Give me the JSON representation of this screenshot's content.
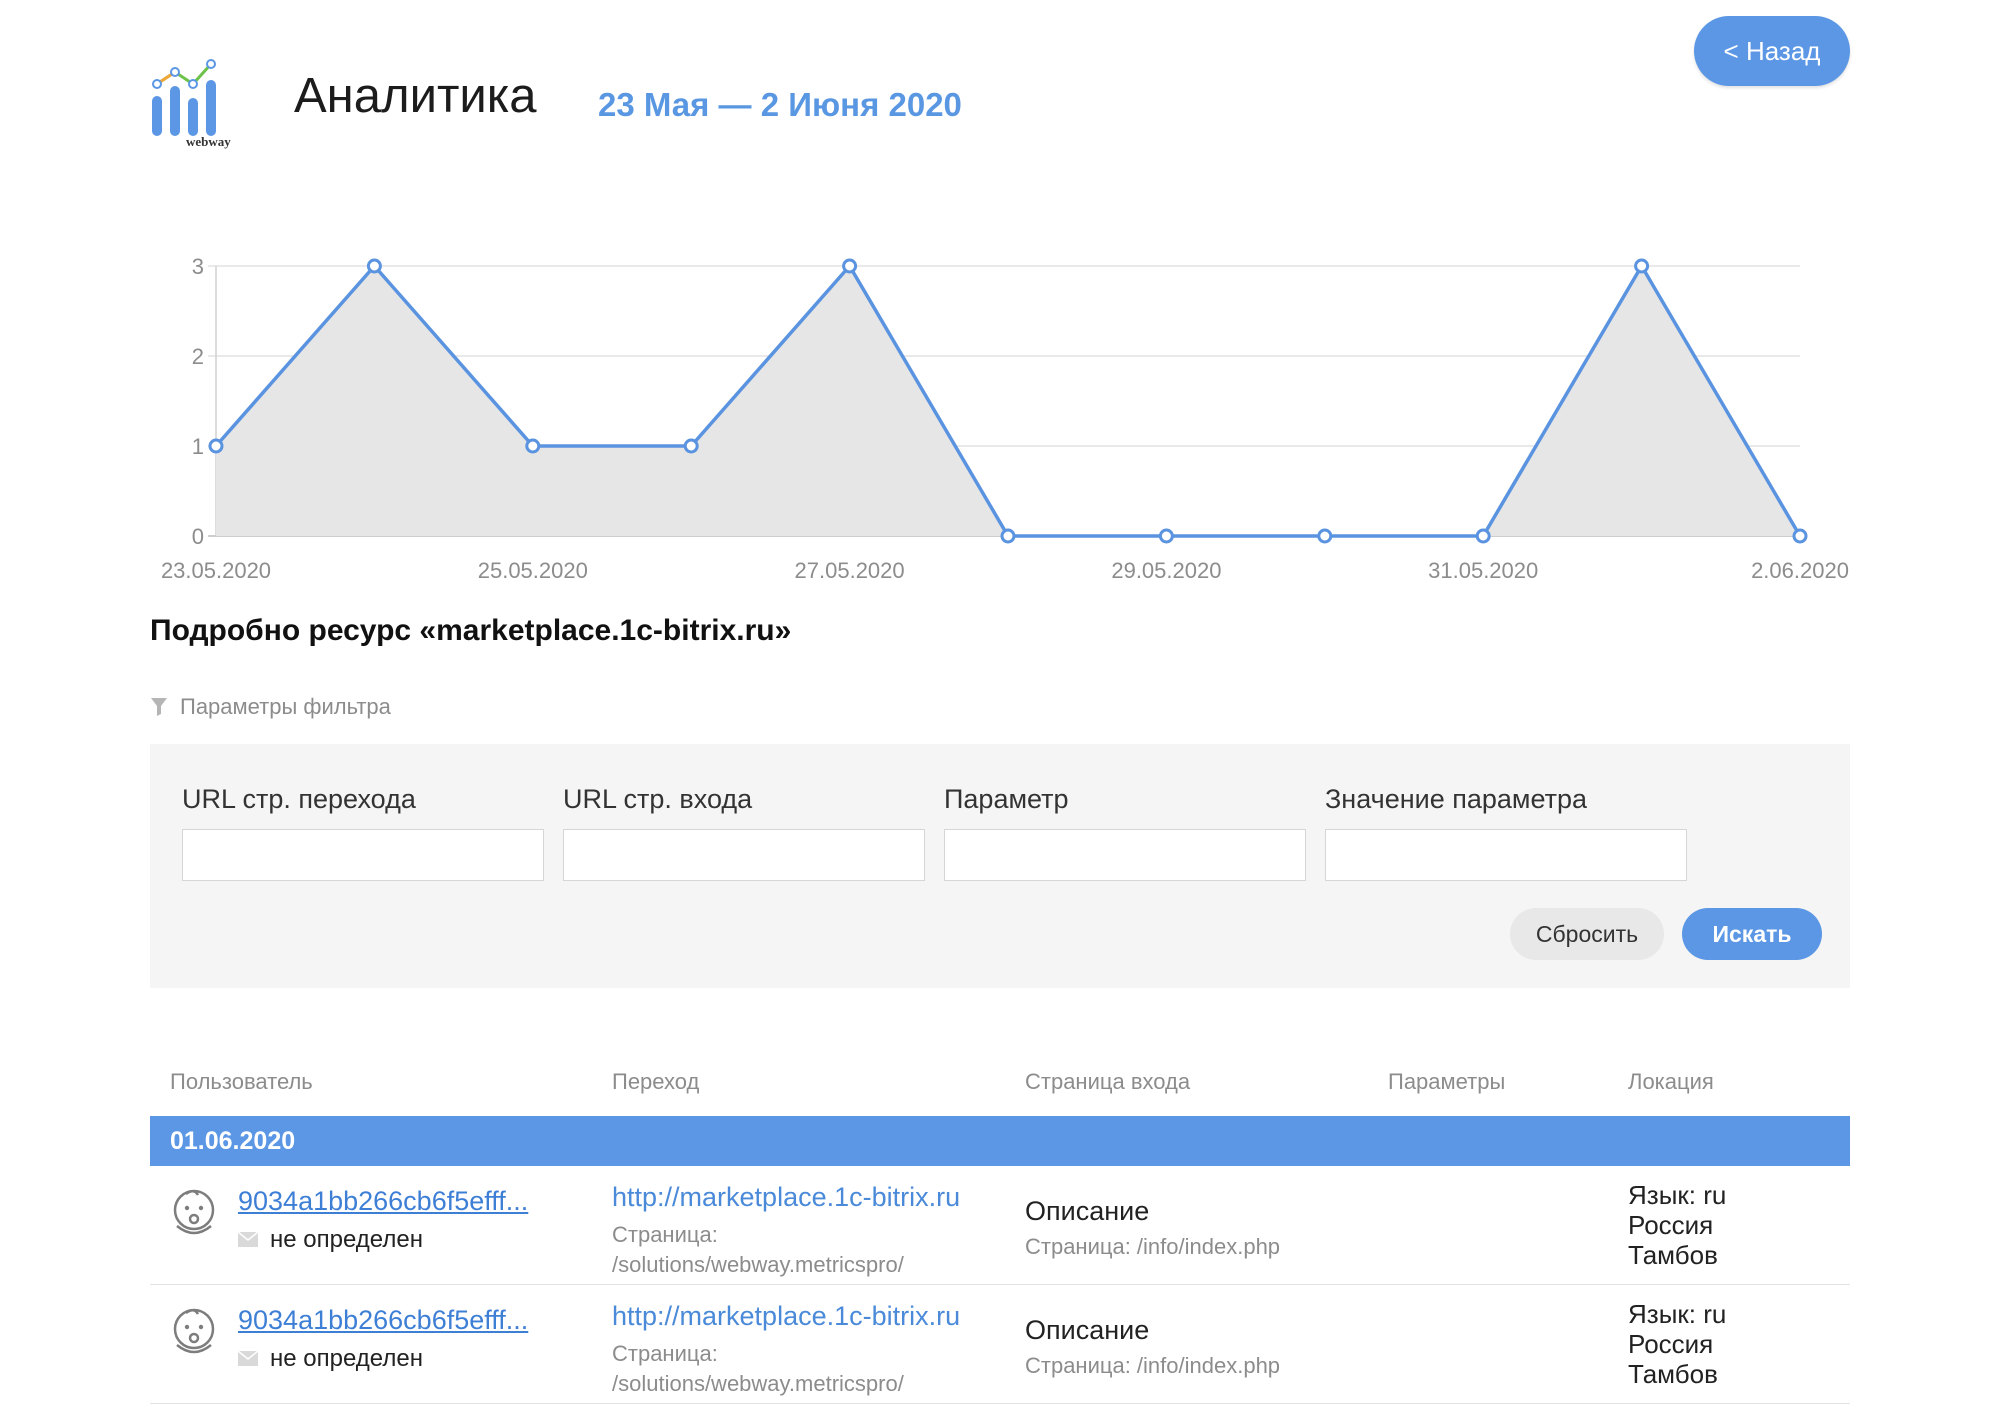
{
  "header": {
    "logo_text": "webway",
    "title": "Аналитика",
    "date_range": "23 Мая — 2 Июня 2020",
    "back_label": "< Назад"
  },
  "colors": {
    "accent": "#5b97e5",
    "chart_line": "#5a93e0",
    "chart_fill": "#e6e6e6"
  },
  "chart_data": {
    "type": "area",
    "x": [
      "23.05.2020",
      "24.05.2020",
      "25.05.2020",
      "26.05.2020",
      "27.05.2020",
      "28.05.2020",
      "29.05.2020",
      "30.05.2020",
      "31.05.2020",
      "1.06.2020",
      "2.06.2020"
    ],
    "x_tick_labels": [
      "23.05.2020",
      "25.05.2020",
      "27.05.2020",
      "29.05.2020",
      "31.05.2020",
      "2.06.2020"
    ],
    "series": [
      {
        "values": [
          1,
          3,
          1,
          1,
          3,
          0,
          0,
          0,
          0,
          3,
          0
        ]
      }
    ],
    "ylim": [
      0,
      3
    ],
    "y_ticks": [
      0,
      1,
      2,
      3
    ],
    "grid": true
  },
  "section": {
    "title": "Подробно ресурс «marketplace.1c-bitrix.ru»",
    "filter_toggle": "Параметры фильтра"
  },
  "filter": {
    "fields": [
      {
        "label": "URL стр. перехода",
        "value": ""
      },
      {
        "label": "URL стр. входа",
        "value": ""
      },
      {
        "label": "Параметр",
        "value": ""
      },
      {
        "label": "Значение параметра",
        "value": ""
      }
    ],
    "reset_label": "Сбросить",
    "search_label": "Искать"
  },
  "table": {
    "columns": [
      "Пользователь",
      "Переход",
      "Страница входа",
      "Параметры",
      "Локация"
    ],
    "date_group": "01.06.2020",
    "rows": [
      {
        "user_id": "9034a1bb266cb6f5efff...",
        "user_status": "не определен",
        "ref_url": "http://marketplace.1c-bitrix.ru",
        "ref_page_label": "Страница:",
        "ref_page": "/solutions/webway.metricspro/",
        "entry_title": "Описание",
        "entry_page": "Страница: /info/index.php",
        "params": "",
        "lang": "Язык: ru",
        "country": "Россия",
        "city": "Тамбов"
      },
      {
        "user_id": "9034a1bb266cb6f5efff...",
        "user_status": "не определен",
        "ref_url": "http://marketplace.1c-bitrix.ru",
        "ref_page_label": "Страница:",
        "ref_page": "/solutions/webway.metricspro/",
        "entry_title": "Описание",
        "entry_page": "Страница: /info/index.php",
        "params": "",
        "lang": "Язык: ru",
        "country": "Россия",
        "city": "Тамбов"
      }
    ]
  }
}
